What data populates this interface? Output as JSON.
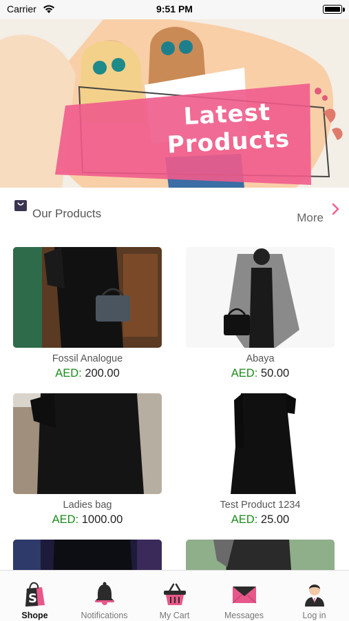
{
  "status_bar": {
    "carrier": "Carrier",
    "time": "9:51 PM"
  },
  "banner": {
    "line1": "Latest",
    "line2": "Products"
  },
  "section": {
    "title": "Our Products",
    "more": "More"
  },
  "products": [
    {
      "name": "Fossil Analogue",
      "currency": "AED:",
      "price": "200.00"
    },
    {
      "name": "Abaya",
      "currency": "AED:",
      "price": "50.00"
    },
    {
      "name": "Ladies bag",
      "currency": "AED:",
      "price": "1000.00"
    },
    {
      "name": "Test Product 1234",
      "currency": "AED:",
      "price": "25.00"
    },
    {
      "name": "",
      "currency": "",
      "price": ""
    },
    {
      "name": "",
      "currency": "",
      "price": ""
    }
  ],
  "tabs": [
    {
      "label": "Shope",
      "icon": "shopify-bag-icon",
      "active": true
    },
    {
      "label": "Notifications",
      "icon": "bell-icon",
      "active": false
    },
    {
      "label": "My Cart",
      "icon": "basket-icon",
      "active": false
    },
    {
      "label": "Messages",
      "icon": "envelope-icon",
      "active": false
    },
    {
      "label": "Log in",
      "icon": "user-avatar-icon",
      "active": false
    }
  ],
  "colors": {
    "accent": "#f2608a",
    "price_green": "#1a8a1a",
    "banner_bg": "#f9cfa8"
  }
}
